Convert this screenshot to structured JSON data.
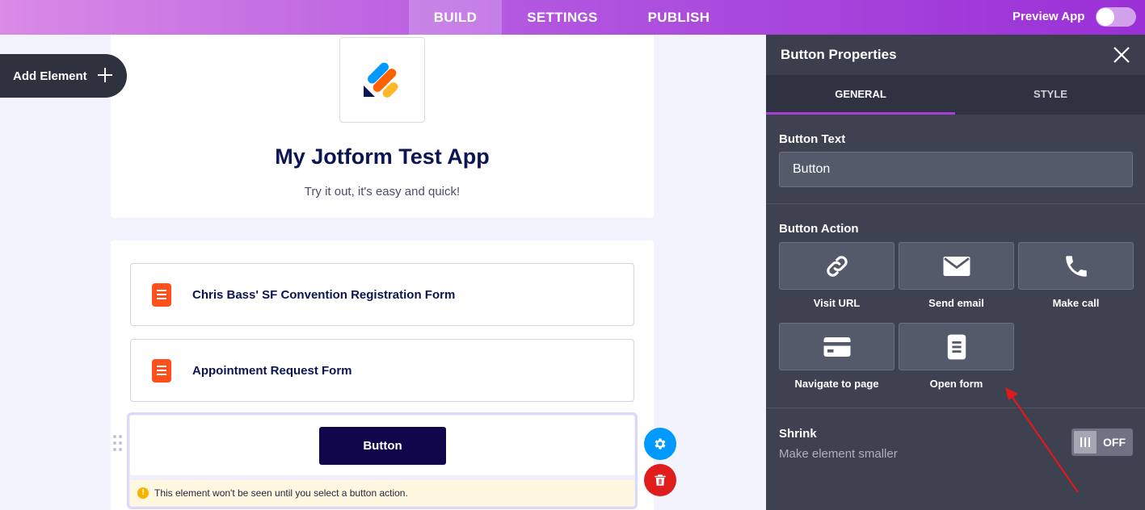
{
  "topnav": {
    "tabs": [
      {
        "label": "BUILD",
        "active": true
      },
      {
        "label": "SETTINGS",
        "active": false
      },
      {
        "label": "PUBLISH",
        "active": false
      }
    ],
    "preview_label": "Preview App",
    "preview_on": false
  },
  "canvas": {
    "add_element_label": "Add Element",
    "app_title": "My Jotform Test App",
    "app_subtitle": "Try it out, it's easy and quick!",
    "forms": [
      {
        "title": "Chris Bass' SF Convention Registration Form"
      },
      {
        "title": "Appointment Request Form"
      }
    ],
    "button_label": "Button",
    "warning": "This element won't be seen until you select a button action."
  },
  "panel": {
    "title": "Button Properties",
    "tabs": [
      {
        "label": "GENERAL",
        "active": true
      },
      {
        "label": "STYLE",
        "active": false
      }
    ],
    "button_text_label": "Button Text",
    "button_text_value": "Button",
    "button_action_label": "Button Action",
    "actions": [
      {
        "label": "Visit URL",
        "icon": "link-icon"
      },
      {
        "label": "Send email",
        "icon": "envelope-icon"
      },
      {
        "label": "Make call",
        "icon": "phone-icon"
      },
      {
        "label": "Navigate to page",
        "icon": "card-icon"
      },
      {
        "label": "Open form",
        "icon": "form-icon"
      }
    ],
    "shrink_title": "Shrink",
    "shrink_sub": "Make element smaller",
    "shrink_state": "OFF"
  },
  "colors": {
    "accent_purple": "#a53fd8",
    "primary_button": "#11054b",
    "form_icon": "#ff4f1a",
    "gear": "#0099ff",
    "trash": "#e01d1d",
    "annotation_arrow": "#e0191f"
  }
}
